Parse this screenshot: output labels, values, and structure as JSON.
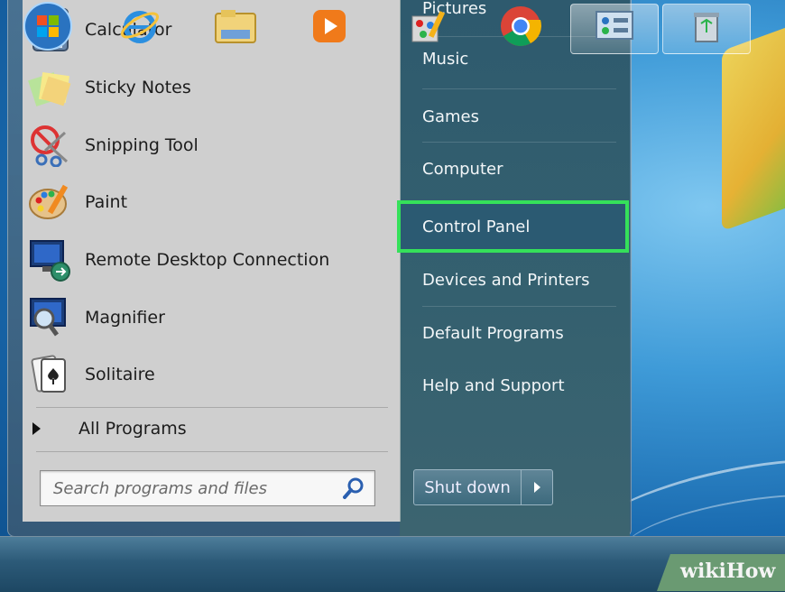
{
  "programs": [
    {
      "label": "Calculator",
      "icon": "calculator-icon"
    },
    {
      "label": "Sticky Notes",
      "icon": "sticky-notes-icon"
    },
    {
      "label": "Snipping Tool",
      "icon": "snipping-tool-icon"
    },
    {
      "label": "Paint",
      "icon": "paint-icon"
    },
    {
      "label": "Remote Desktop Connection",
      "icon": "remote-desktop-icon"
    },
    {
      "label": "Magnifier",
      "icon": "magnifier-icon"
    },
    {
      "label": "Solitaire",
      "icon": "solitaire-icon"
    }
  ],
  "all_programs": "All Programs",
  "search": {
    "placeholder": "Search programs and files"
  },
  "right_items": [
    {
      "label": "Pictures"
    },
    {
      "label": "Music"
    },
    {
      "label": "Games"
    },
    {
      "label": "Computer"
    },
    {
      "label": "Control Panel",
      "highlighted": true
    },
    {
      "label": "Devices and Printers"
    },
    {
      "label": "Default Programs"
    },
    {
      "label": "Help and Support"
    }
  ],
  "shutdown_label": "Shut down",
  "highlight_color": "#35e05a",
  "taskbar": [
    {
      "icon": "start-orb-icon"
    },
    {
      "icon": "internet-explorer-icon"
    },
    {
      "icon": "file-explorer-icon"
    },
    {
      "icon": "media-player-icon"
    },
    {
      "icon": "paint-app-icon"
    },
    {
      "icon": "chrome-icon"
    },
    {
      "icon": "control-panel-icon",
      "active": true
    },
    {
      "icon": "recycle-app-icon",
      "active": true
    }
  ],
  "watermark": "wikiHow"
}
